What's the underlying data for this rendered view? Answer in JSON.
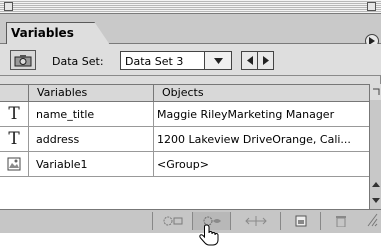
{
  "panel": {
    "tab_title": "Variables"
  },
  "toolbar": {
    "data_set_label": "Data Set:",
    "data_set_value": "Data Set 3"
  },
  "table": {
    "headers": [
      "Variables",
      "Objects"
    ],
    "rows": [
      {
        "icon": "text-variable-icon",
        "glyph": "T",
        "variable": "name_title",
        "object": "Maggie RileyMarketing Manager"
      },
      {
        "icon": "text-variable-icon",
        "glyph": "T",
        "variable": "address",
        "object": "1200 Lakeview DriveOrange, Cali..."
      },
      {
        "icon": "image-variable-icon",
        "glyph": "",
        "variable": "Variable1",
        "object": "<Group>"
      }
    ]
  },
  "bottom_bar": {
    "buttons": [
      "unbind-variable-icon",
      "make-visibility-dynamic-icon",
      "make-text-dynamic-icon",
      "new-variable-icon",
      "trash-icon"
    ]
  },
  "icons": {
    "capture-data-set": "camera-icon",
    "prev": "left-arrow-icon",
    "next": "right-arrow-icon",
    "menu": "panel-menu-icon",
    "cursor": "hand-pointer-icon"
  }
}
